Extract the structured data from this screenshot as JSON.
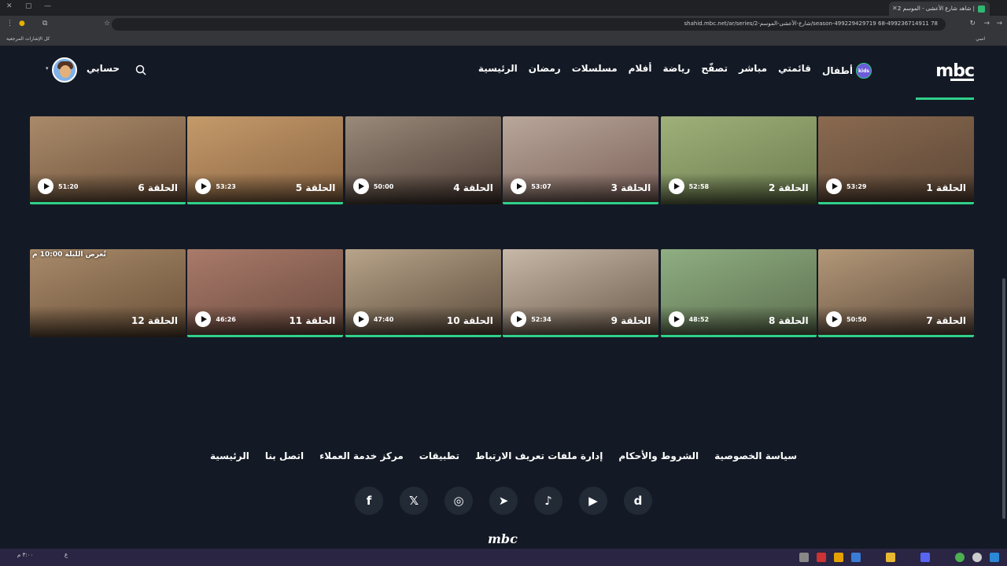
{
  "browser": {
    "tab_title": "شاهد شارع الأعشى - الموسم 2 |",
    "url": "shahid.mbc.net/ar/series/شارع-الأعشى-الموسم-2/season-499229429719 68-499236714911 78",
    "bookmarks_label": "كل الإشارات المرجعية",
    "bookmark_item": "اسي"
  },
  "header": {
    "logo": "mbc",
    "nav": [
      "الرئيسية",
      "رمضان",
      "مسلسلات",
      "أفلام",
      "رياضة",
      "تصفّح",
      "مباشر",
      "قائمتي"
    ],
    "kids_label": "أطفال",
    "kids_badge": "kids",
    "account_label": "حسابي"
  },
  "episodes": [
    {
      "title": "الحلقة 1",
      "duration": "53:29",
      "watched": true,
      "colors": [
        "#8a6a50",
        "#5b4636"
      ]
    },
    {
      "title": "الحلقة 2",
      "duration": "52:58",
      "watched": false,
      "colors": [
        "#9fb07a",
        "#6c7d4e"
      ]
    },
    {
      "title": "الحلقة 3",
      "duration": "53:07",
      "watched": true,
      "colors": [
        "#b9a79a",
        "#7a5f58"
      ]
    },
    {
      "title": "الحلقة 4",
      "duration": "50:00",
      "watched": false,
      "colors": [
        "#9a8a7a",
        "#4a3a33"
      ]
    },
    {
      "title": "الحلقة 5",
      "duration": "53:23",
      "watched": true,
      "colors": [
        "#c49a6a",
        "#8a6442"
      ]
    },
    {
      "title": "الحلقة 6",
      "duration": "51:20",
      "watched": true,
      "colors": [
        "#a98a6a",
        "#6d513a"
      ]
    },
    {
      "title": "الحلقة 7",
      "duration": "50:50",
      "watched": true,
      "colors": [
        "#b39878",
        "#5e4a3c"
      ]
    },
    {
      "title": "الحلقة 8",
      "duration": "48:52",
      "watched": true,
      "colors": [
        "#8fae82",
        "#5c6e4e"
      ]
    },
    {
      "title": "الحلقة 9",
      "duration": "52:34",
      "watched": true,
      "colors": [
        "#c8b8a8",
        "#6a5a4a"
      ]
    },
    {
      "title": "الحلقة 10",
      "duration": "47:40",
      "watched": true,
      "colors": [
        "#b8a48a",
        "#5a4a3a"
      ]
    },
    {
      "title": "الحلقة 11",
      "duration": "46:26",
      "watched": true,
      "colors": [
        "#a97a6a",
        "#6a4a3e"
      ]
    },
    {
      "title": "الحلقة 12",
      "duration": "",
      "watched": false,
      "badge": "تُعرض الليلة 10:00 م",
      "colors": [
        "#a88a6a",
        "#6a5038"
      ]
    }
  ],
  "footer": {
    "links": [
      "الرئيسية",
      "اتصل بنا",
      "مركز خدمة العملاء",
      "تطبيقات",
      "إدارة ملفات تعريف الارتباط",
      "الشروط والأحكام",
      "سياسة الخصوصية"
    ],
    "social": [
      {
        "icon": "dailymotion-icon",
        "glyph": "d"
      },
      {
        "icon": "youtube-icon",
        "glyph": "▶"
      },
      {
        "icon": "tiktok-icon",
        "glyph": "♪"
      },
      {
        "icon": "telegram-icon",
        "glyph": "➤"
      },
      {
        "icon": "instagram-icon",
        "glyph": "◎"
      },
      {
        "icon": "x-icon",
        "glyph": "𝕏"
      },
      {
        "icon": "facebook-icon",
        "glyph": "f"
      }
    ],
    "logo": "mbc"
  },
  "taskbar": {
    "time": "٣:٠٠ م",
    "lang": "ع"
  },
  "colors": {
    "accent": "#2fd08a",
    "background": "#141a25"
  }
}
